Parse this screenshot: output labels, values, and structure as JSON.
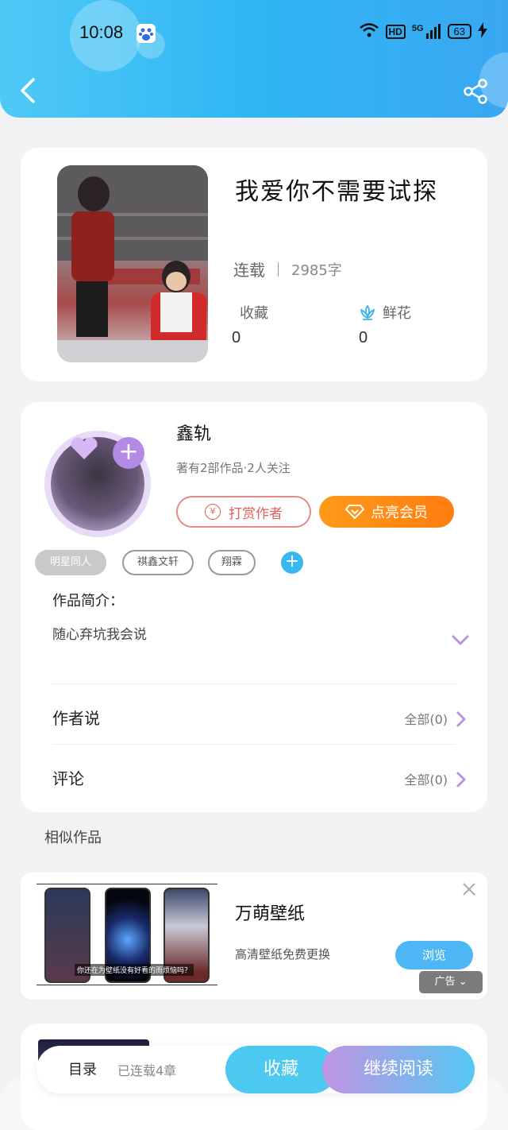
{
  "status_bar": {
    "time": "10:08",
    "network": "5G",
    "hd": "HD",
    "battery": "63"
  },
  "colors": {
    "header_gradient_start": "#4fc9f6",
    "header_gradient_end": "#3aa7f2",
    "accent_blue": "#39b7f0",
    "vip_orange": "#ff8a14",
    "reward_red": "#e0605a",
    "accent_purple": "#b38be6"
  },
  "header": {
    "back_icon": "chevron-left-icon",
    "share_icon": "share-icon"
  },
  "book": {
    "title": "我爱你不需要试探",
    "status": "连载",
    "word_count": "2985字",
    "favorites_label": "收藏",
    "favorites_value": "0",
    "flowers_label": "鲜花",
    "flowers_value": "0"
  },
  "author": {
    "name": "鑫轨",
    "stats": "著有2部作品·2人关注",
    "reward_label": "打赏作者",
    "vip_label": "点亮会员",
    "tags": [
      "明星同人",
      "祺鑫文轩",
      "翔霖"
    ],
    "intro_label": "作品简介：",
    "intro_text": "随心弃坑我会说"
  },
  "rows": {
    "author_says_label": "作者说",
    "author_says_value": "全部(0)",
    "comments_label": "评论",
    "comments_value": "全部(0)"
  },
  "similar": {
    "title": "相似作品"
  },
  "ad": {
    "title": "万萌壁纸",
    "description": "高清壁纸免费更换",
    "button": "浏览",
    "badge": "广告",
    "caption": "你还在为壁纸没有好看的而烦恼吗？"
  },
  "bottom_bar": {
    "toc_label": "目录",
    "chapters": "已连载4章",
    "favorite_button": "收藏",
    "continue_button": "继续阅读"
  }
}
